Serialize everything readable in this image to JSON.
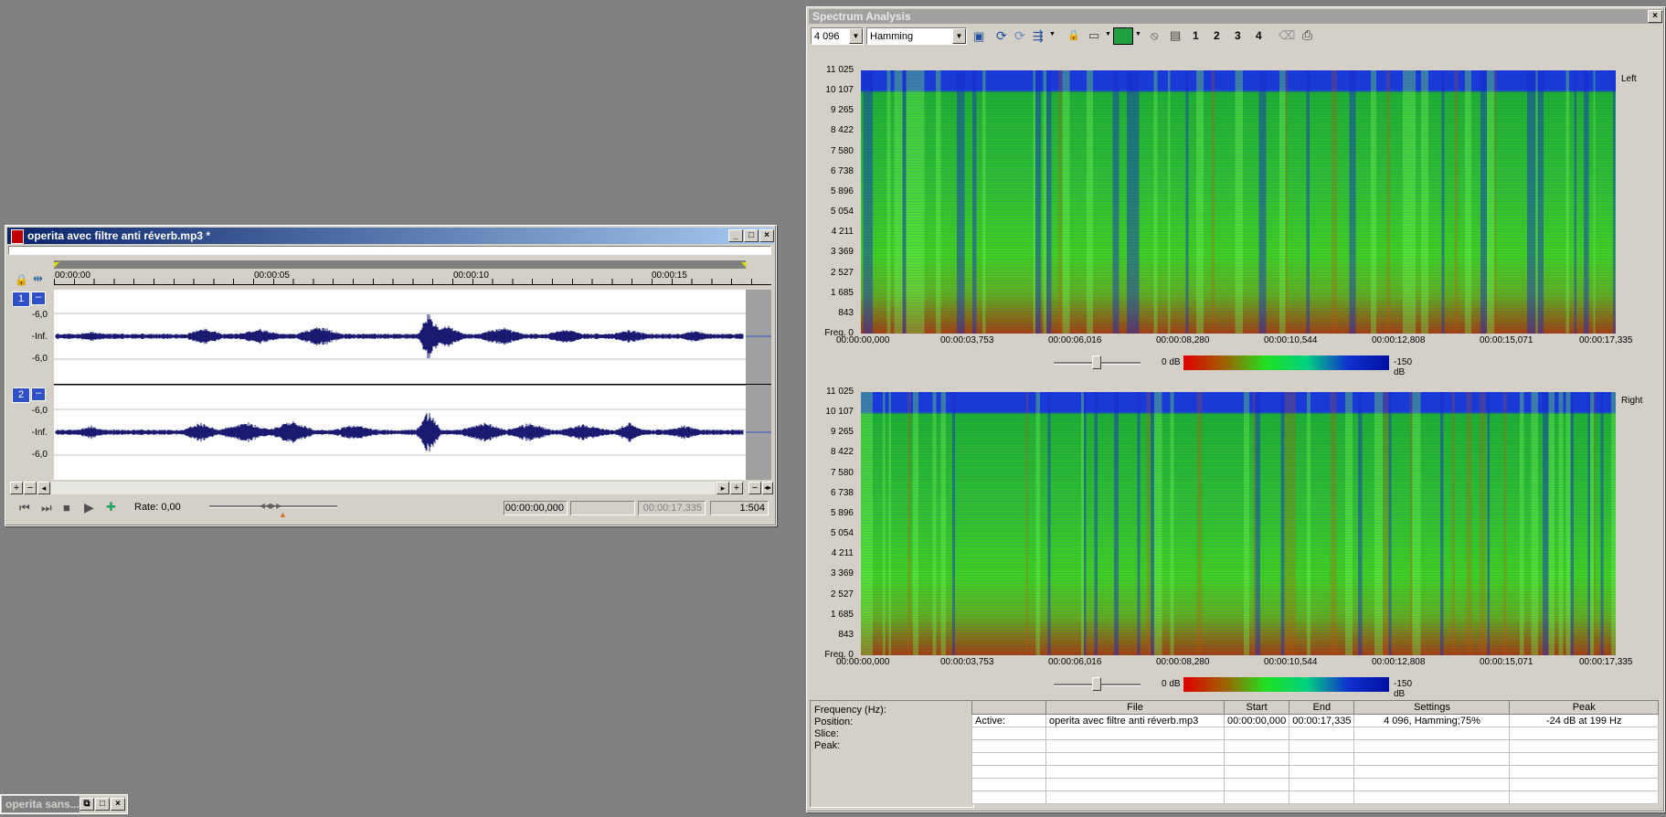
{
  "wave_window": {
    "title": "operita avec filtre anti réverb.mp3 *",
    "ruler_ticks": [
      "00:00:00",
      "00:00:05",
      "00:00:10",
      "00:00:15"
    ],
    "channels": [
      {
        "number": "1",
        "labels": [
          "-6,0",
          "-Inf.",
          "-6,0"
        ]
      },
      {
        "number": "2",
        "labels": [
          "-6,0",
          "-Inf.",
          "-6,0"
        ]
      }
    ],
    "rate_label": "Rate: 0,00",
    "cursor_time": "00:00:00,000",
    "selection_length": "",
    "end_time": "00:00:17,335",
    "zoom": "1:504",
    "bottom_buttons": [
      "+",
      "−",
      "◂",
      "▸",
      "+",
      "−",
      "◂▸"
    ]
  },
  "minimized_window": {
    "title": "operita sans..."
  },
  "spectrum_window": {
    "title": "Spectrum Analysis",
    "fft_size": "4 096",
    "window_type": "Hamming",
    "toolbar_numbers": [
      "1",
      "2",
      "3",
      "4"
    ],
    "freq_axis_label": "Freq. 0",
    "freq_ticks": [
      "11 025",
      "10 107",
      "9 265",
      "8 422",
      "7 580",
      "6 738",
      "5 896",
      "5 054",
      "4 211",
      "3 369",
      "2 527",
      "1 685",
      "843"
    ],
    "time_ticks": [
      "00:00:00,000",
      "00:00:03,753",
      "00:00:06,016",
      "00:00:08,280",
      "00:00:10,544",
      "00:00:12,808",
      "00:00:15,071",
      "00:00:17,335"
    ],
    "channels": [
      {
        "name": "Left",
        "scale_max": "0 dB",
        "scale_min": "-150 dB"
      },
      {
        "name": "Right",
        "scale_max": "0 dB",
        "scale_min": "-150 dB"
      }
    ],
    "info_labels": [
      "Frequency (Hz):",
      "Position:",
      "Slice:",
      "Peak:"
    ],
    "table": {
      "headers": [
        "",
        "File",
        "Start",
        "End",
        "Settings",
        "Peak"
      ],
      "rows": [
        [
          "Active:",
          "operita avec filtre anti réverb.mp3",
          "00:00:00,000",
          "00:00:17,335",
          "4 096, Hamming;75%",
          "-24 dB at 199 Hz"
        ]
      ]
    },
    "colors": {
      "low": "#1030c0",
      "mid": "#20d020",
      "high": "#c02000"
    }
  }
}
